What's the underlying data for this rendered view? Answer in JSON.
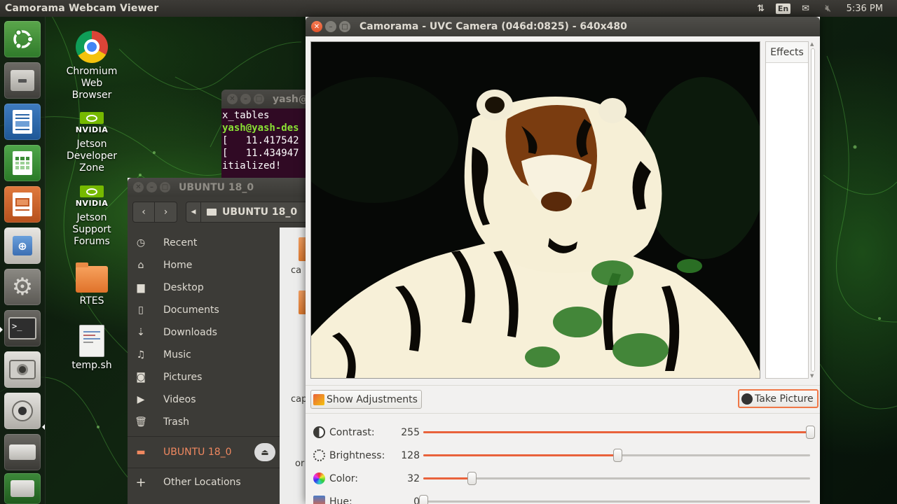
{
  "top_panel": {
    "app_title": "Camorama Webcam Viewer",
    "keyboard_layout": "En",
    "clock": "5:36 PM",
    "icons": [
      "network-transfer-icon",
      "keyboard-layout-icon",
      "mail-icon",
      "volume-muted-icon"
    ]
  },
  "launcher": {
    "items": [
      "ubuntu-logo-icon",
      "files-icon",
      "libreoffice-writer-icon",
      "libreoffice-calc-icon",
      "libreoffice-impress-icon",
      "software-center-icon",
      "system-settings-icon",
      "terminal-icon",
      "camera-icon",
      "webcam-icon",
      "drive-icon",
      "usb-drive-icon"
    ]
  },
  "desktop_icons": [
    {
      "label": "Chromium\nWeb\nBrowser",
      "lines": [
        "Chromium",
        "Web",
        "Browser"
      ],
      "icon": "chromium-icon"
    },
    {
      "lines": [
        "Jetson",
        "Developer",
        "Zone"
      ],
      "icon": "nvidia-icon"
    },
    {
      "lines": [
        "Jetson",
        "Support",
        "Forums"
      ],
      "icon": "nvidia-icon"
    },
    {
      "lines": [
        "RTES"
      ],
      "icon": "folder-icon"
    },
    {
      "lines": [
        "temp.sh"
      ],
      "icon": "text-file-icon"
    }
  ],
  "nvidia_brand": "NVIDIA",
  "terminal": {
    "title": "yash@",
    "lines": [
      "x_tables",
      "yash@yash-des",
      "[   11.417542",
      "[   11.434947",
      "itialized!"
    ]
  },
  "files": {
    "title": "UBUNTU 18_0",
    "path_crumb": "UBUNTU 18_0",
    "sidebar": [
      {
        "label": "Recent",
        "icon": "clock-icon"
      },
      {
        "label": "Home",
        "icon": "home-icon"
      },
      {
        "label": "Desktop",
        "icon": "folder-icon"
      },
      {
        "label": "Documents",
        "icon": "document-icon"
      },
      {
        "label": "Downloads",
        "icon": "download-icon"
      },
      {
        "label": "Music",
        "icon": "music-icon"
      },
      {
        "label": "Pictures",
        "icon": "camera-icon"
      },
      {
        "label": "Videos",
        "icon": "video-icon"
      },
      {
        "label": "Trash",
        "icon": "trash-icon"
      }
    ],
    "drive": {
      "label": "UBUNTU 18_0",
      "icon": "drive-icon"
    },
    "other_locations": "Other Locations",
    "content_labels": [
      "ca",
      "cap",
      "or"
    ]
  },
  "camorama": {
    "title": "Camorama - UVC Camera (046d:0825) - 640x480",
    "effects_header": "Effects",
    "show_adjustments": "Show Adjustments",
    "take_picture": "Take Picture",
    "adjustments": [
      {
        "label": "Contrast:",
        "value": 255,
        "max": 255,
        "icon": "contrast-icon",
        "color": "#3c3b37"
      },
      {
        "label": "Brightness:",
        "value": 128,
        "max": 255,
        "icon": "brightness-icon",
        "color": "#3c3b37"
      },
      {
        "label": "Color:",
        "value": 32,
        "max": 255,
        "icon": "color-wheel-icon",
        "color": "#e9623b"
      },
      {
        "label": "Hue:",
        "value": 0,
        "max": 255,
        "icon": "hue-icon",
        "color": "#4a7cc7"
      }
    ]
  },
  "colors": {
    "accent": "#e9623b",
    "panel": "#3c3b37",
    "terminal_bg": "#300a24"
  }
}
